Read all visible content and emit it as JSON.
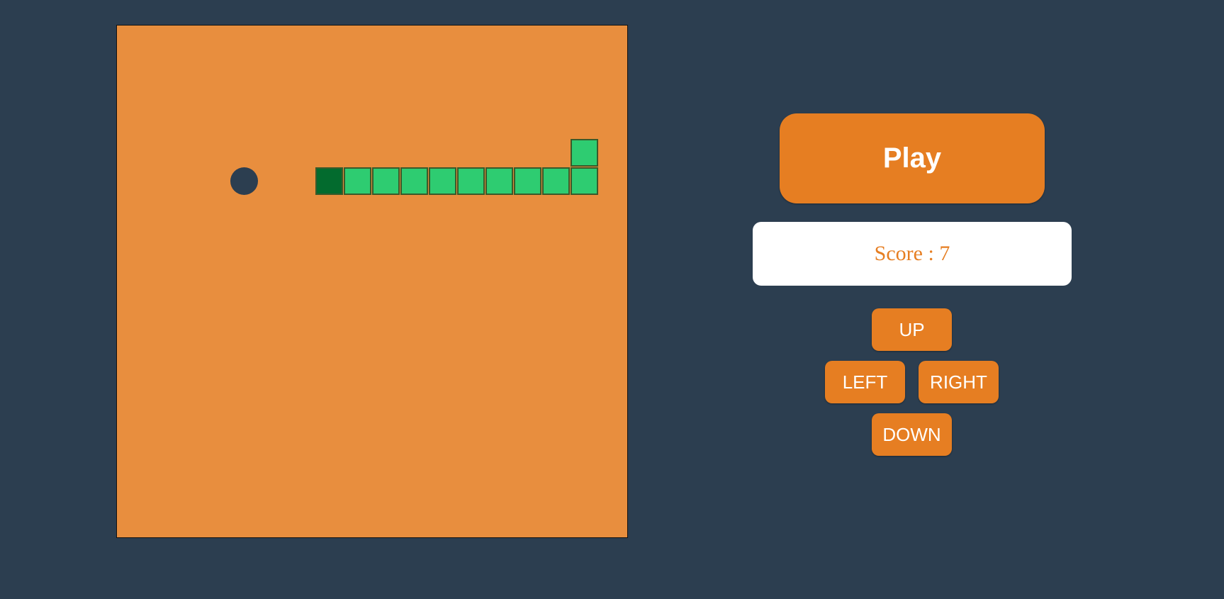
{
  "colors": {
    "background": "#2c3e50",
    "board": "#e88e3e",
    "snake_body": "#2ecc71",
    "snake_head": "#036b2e",
    "food": "#2c3e50",
    "button": "#e67e22",
    "score_text": "#e67e22"
  },
  "controls": {
    "play_label": "Play",
    "score_label": "Score : 7",
    "up_label": "UP",
    "left_label": "LEFT",
    "right_label": "RIGHT",
    "down_label": "DOWN"
  },
  "game": {
    "grid_size": 18,
    "score": 7,
    "food": {
      "col": 4,
      "row": 5
    },
    "snake": [
      {
        "col": 7,
        "row": 5,
        "head": true
      },
      {
        "col": 8,
        "row": 5
      },
      {
        "col": 9,
        "row": 5
      },
      {
        "col": 10,
        "row": 5
      },
      {
        "col": 11,
        "row": 5
      },
      {
        "col": 12,
        "row": 5
      },
      {
        "col": 13,
        "row": 5
      },
      {
        "col": 14,
        "row": 5
      },
      {
        "col": 15,
        "row": 5
      },
      {
        "col": 16,
        "row": 5
      },
      {
        "col": 16,
        "row": 4
      }
    ]
  }
}
